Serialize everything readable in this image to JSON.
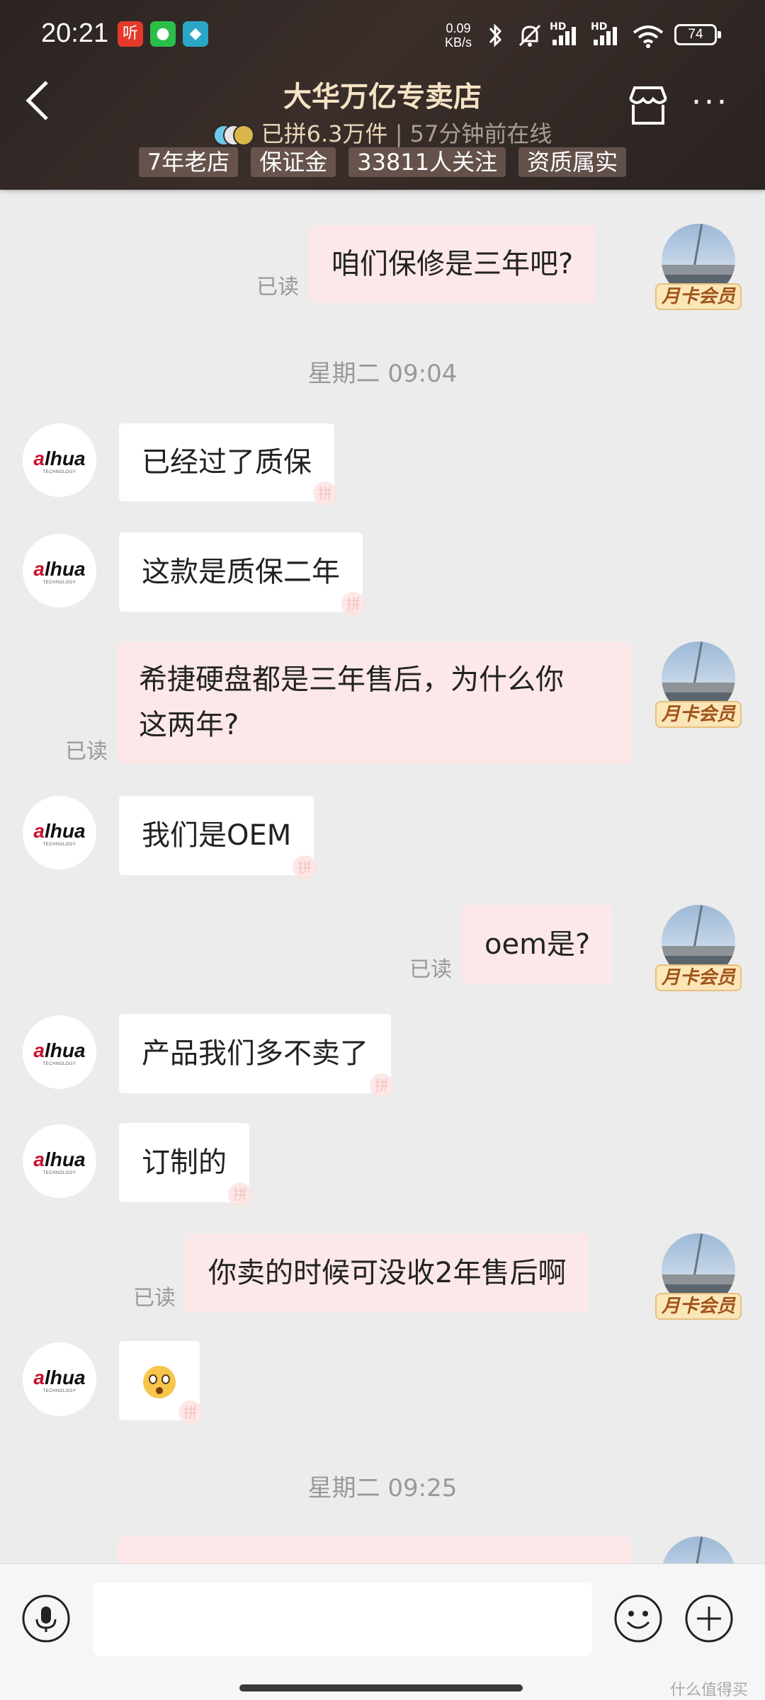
{
  "status_bar": {
    "time": "20:21",
    "net_speed_value": "0.09",
    "net_speed_unit": "KB/s",
    "signal_label_1": "HD",
    "signal_label_2": "HD",
    "battery": "74",
    "app_badges": [
      {
        "icon": "listen-app-icon",
        "glyph": "听",
        "color": "#e53a2b"
      },
      {
        "icon": "wechat-icon",
        "glyph": "●",
        "color": "#2bbf4a"
      },
      {
        "icon": "blue-app-icon",
        "glyph": "◆",
        "color": "#2aa7c7"
      }
    ]
  },
  "header": {
    "shop_name": "大华万亿专卖店",
    "sales": "已拼6.3万件",
    "last_online": "57分钟前在线",
    "tags": [
      "7年老店",
      "保证金",
      "33811人关注",
      "资质属实"
    ],
    "more_label": "···"
  },
  "shop_logo": {
    "text_a": "a",
    "text_rest": "lhua",
    "sub": "TECHNOLOGY"
  },
  "vip_label": "月卡会员",
  "read_label": "已读",
  "messages": [
    {
      "from": "me",
      "text": "咱们保修是三年吧?"
    },
    {
      "type": "time",
      "text": "星期二 09:04"
    },
    {
      "from": "shop",
      "text": "已经过了质保"
    },
    {
      "from": "shop",
      "text": "这款是质保二年"
    },
    {
      "from": "me",
      "text_line1": "希捷硬盘都是三年售后，为什么你",
      "text_line2": "这两年?"
    },
    {
      "from": "shop",
      "text": "我们是OEM"
    },
    {
      "from": "me",
      "text": "oem是?"
    },
    {
      "from": "shop",
      "text": "产品我们多不卖了"
    },
    {
      "from": "shop",
      "text": "订制的"
    },
    {
      "from": "me",
      "text": "你卖的时候可没收2年售后啊"
    },
    {
      "from": "shop",
      "emoji": "dizzy-face-emoji"
    },
    {
      "type": "time",
      "text": "星期二 09:25"
    }
  ],
  "input": {
    "placeholder": "",
    "value": ""
  },
  "watermark": "什么值得买",
  "colors": {
    "header_bg": "#2b2422",
    "shop_name": "#f5e3c5",
    "my_bubble": "#fce8e8",
    "shop_bubble": "#ffffff",
    "vip_badge_bg": "#fbe6b8",
    "chat_bg": "#ececec"
  }
}
